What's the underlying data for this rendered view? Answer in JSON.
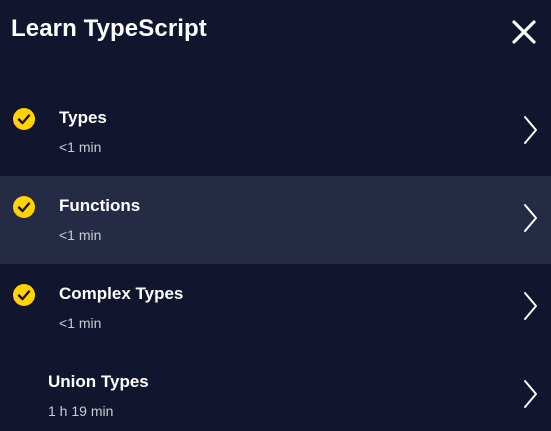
{
  "header": {
    "title": "Learn TypeScript",
    "close_icon": "close-icon"
  },
  "colors": {
    "background": "#11152d",
    "active_row": "#262b45",
    "check": "#ffd200",
    "text": "#ffffff",
    "subtext": "#c9cbd6"
  },
  "lessons": [
    {
      "title": "Types",
      "duration": "<1 min",
      "completed": true,
      "active": false,
      "icon": "check-circle-icon"
    },
    {
      "title": "Functions",
      "duration": "<1 min",
      "completed": true,
      "active": true,
      "icon": "check-circle-icon"
    },
    {
      "title": "Complex Types",
      "duration": "<1 min",
      "completed": true,
      "active": false,
      "icon": "check-circle-icon"
    },
    {
      "title": "Union Types",
      "duration": "1 h 19 min",
      "completed": false,
      "active": false
    }
  ]
}
